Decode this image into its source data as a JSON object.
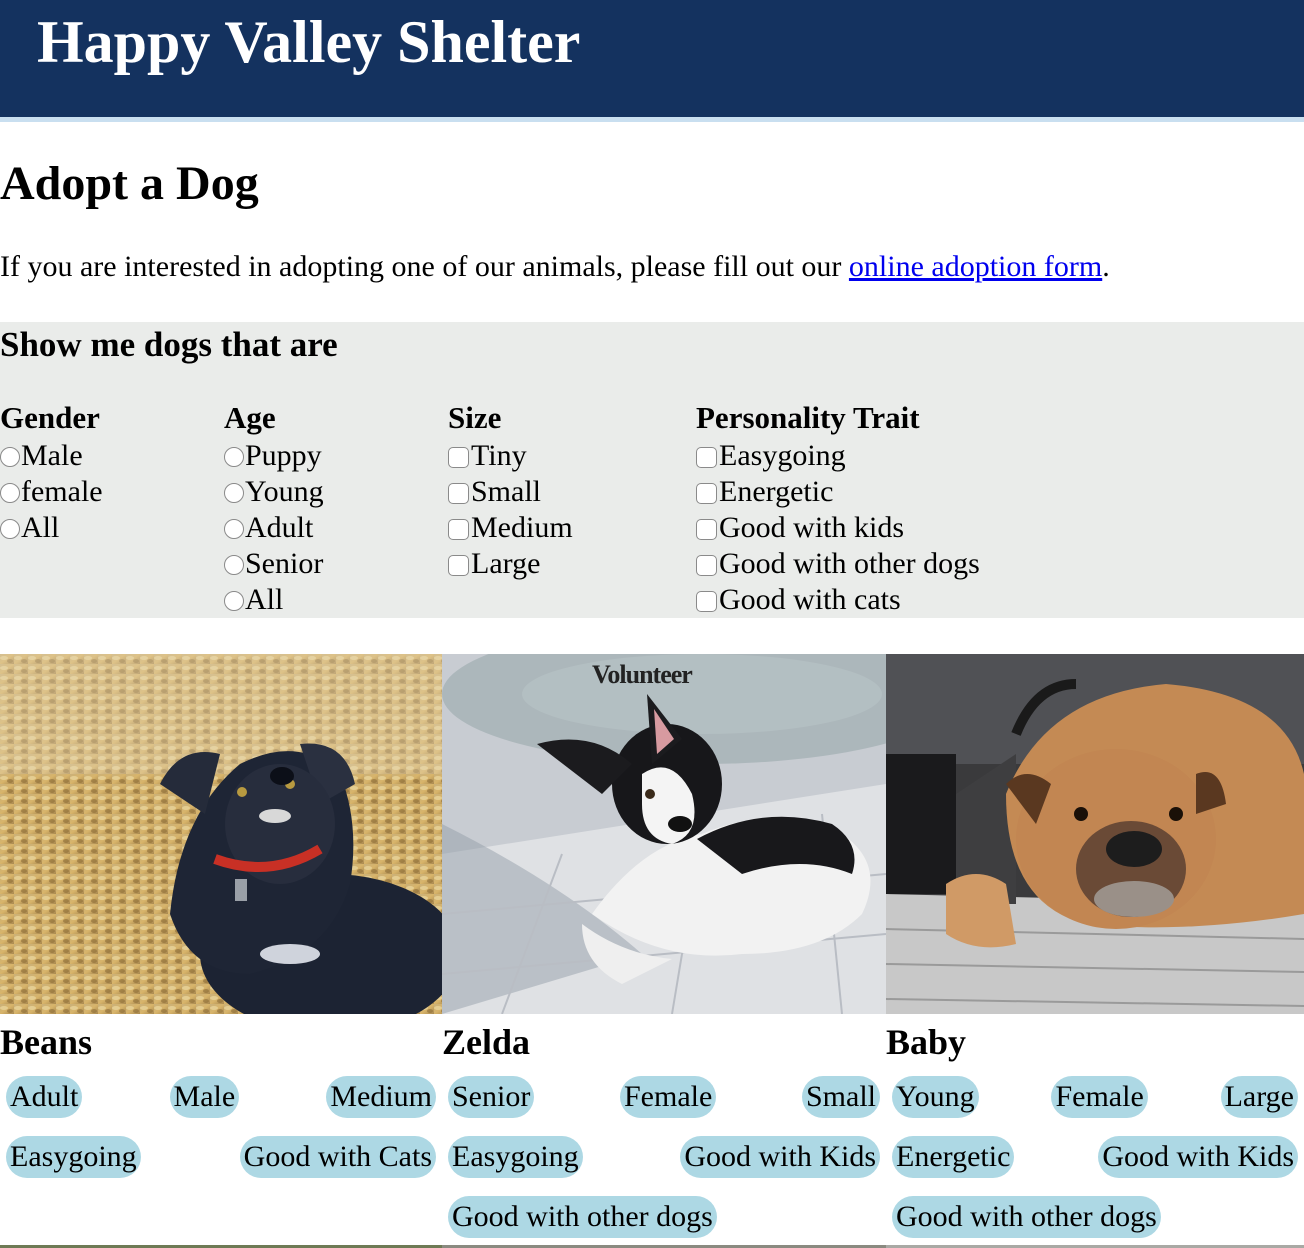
{
  "header": {
    "title": "Happy Valley Shelter"
  },
  "main": {
    "title": "Adopt a Dog",
    "intro_prefix": "If you are interested in adopting one of our animals, please fill out our ",
    "intro_link": "online adoption form",
    "intro_suffix": "."
  },
  "filters": {
    "heading": "Show me dogs that are",
    "gender": {
      "title": "Gender",
      "options": [
        "Male",
        "female",
        "All"
      ]
    },
    "age": {
      "title": "Age",
      "options": [
        "Puppy",
        "Young",
        "Adult",
        "Senior",
        "All"
      ]
    },
    "size": {
      "title": "Size",
      "options": [
        "Tiny",
        "Small",
        "Medium",
        "Large"
      ]
    },
    "personality": {
      "title": "Personality Trait",
      "options": [
        "Easygoing",
        "Energetic",
        "Good with kids",
        "Good with other dogs",
        "Good with cats"
      ]
    }
  },
  "dogs": [
    {
      "name": "Beans",
      "tags_row1": [
        "Adult",
        "Male",
        "Medium"
      ],
      "tags_row2": [
        "Easygoing",
        "Good with Cats"
      ],
      "tags_row3": []
    },
    {
      "name": "Zelda",
      "overlay": "Volunteer",
      "tags_row1": [
        "Senior",
        "Female",
        "Small"
      ],
      "tags_row2": [
        "Easygoing",
        "Good with Kids"
      ],
      "tags_row3": [
        "Good with other dogs"
      ]
    },
    {
      "name": "Baby",
      "tags_row1": [
        "Young",
        "Female",
        "Large"
      ],
      "tags_row2": [
        "Energetic",
        "Good with Kids"
      ],
      "tags_row3": [
        "Good with other dogs"
      ]
    }
  ],
  "colors": {
    "header_bg": "#14325f",
    "tag_bg": "#add8e4",
    "panel_bg": "#eaecea",
    "link": "#0000ee"
  }
}
